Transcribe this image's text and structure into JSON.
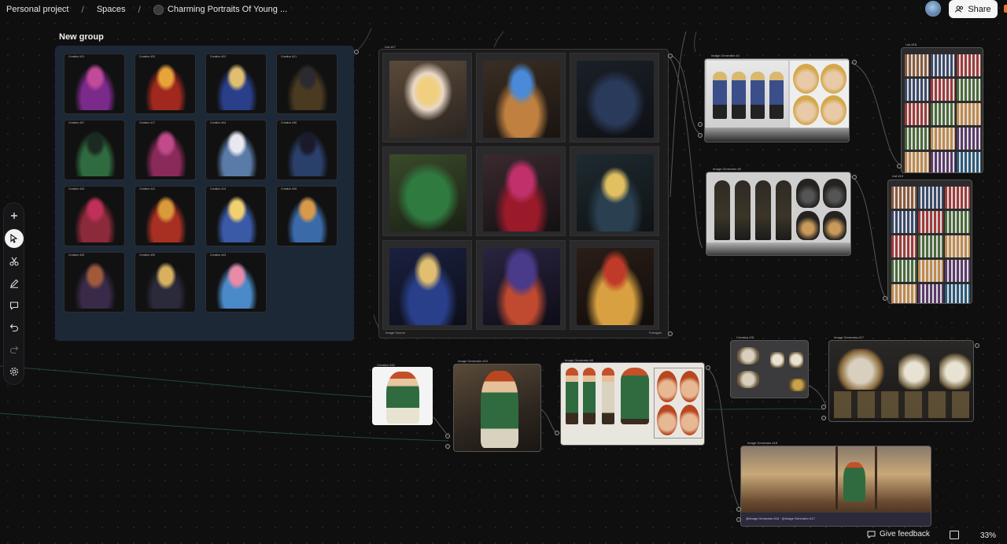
{
  "breadcrumb": {
    "project": "Personal project",
    "spaces": "Spaces",
    "space_title": "Charming Portraits Of Young ...",
    "separator": "/"
  },
  "header": {
    "share_label": "Share"
  },
  "toolbar": {
    "tools": [
      "add-icon",
      "select-icon",
      "cut-icon",
      "draw-icon",
      "comment-icon",
      "undo-icon",
      "redo-icon",
      "settings-icon"
    ]
  },
  "group": {
    "title": "New group",
    "tile_labels": [
      "Creation #31",
      "Creation #20",
      "Creation #22",
      "Creation #21",
      "Creation #37",
      "Creation #17",
      "Creation #44",
      "Creation #36",
      "Creation #33",
      "Creation #12",
      "Creation #14",
      "Creation #26",
      "Creation #35",
      "Creation #30",
      "Creation #43"
    ]
  },
  "grid_node": {
    "label": "List #17",
    "footer_left": "Image Source",
    "footer_right": "9 images"
  },
  "image_nodes": {
    "gen_top": "Image Generator #3",
    "gen_mid": "Image Generator #5",
    "list_top": "List #18",
    "list_mid": "List #19",
    "creation_small": "Creation #32",
    "gen_a": "Image Generator #10",
    "gen_b": "Image Generator #8",
    "creation_beast": "Creation #31",
    "gen_beast": "Image Generator #17",
    "gen_ship": "Image Generator #18",
    "ship_prompt": "@Image Generator #18 · @Image Generator #17"
  },
  "footer": {
    "feedback_label": "Give feedback",
    "zoom": "33%"
  },
  "colors": {
    "canvas": "#0f0f10",
    "group_bg": "#1d2837",
    "accent_orange": "#e8742c"
  }
}
